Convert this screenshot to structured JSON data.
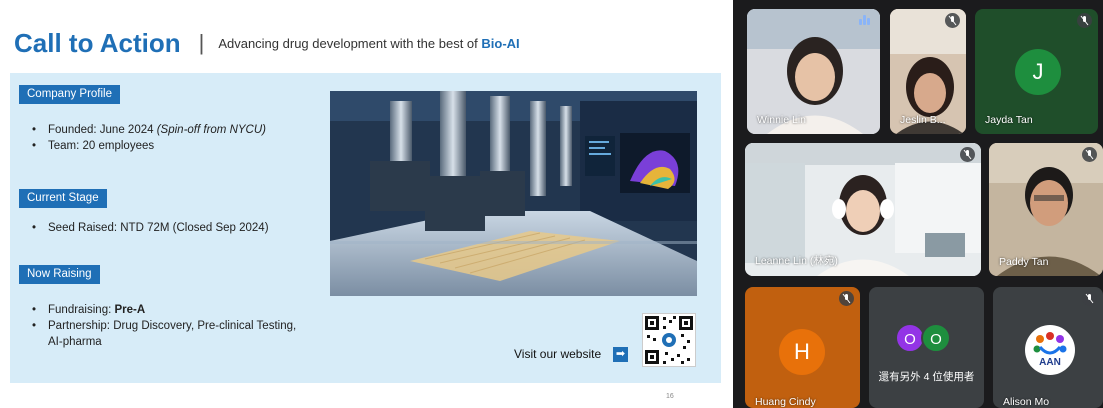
{
  "slide": {
    "title": "Call to Action",
    "separator": "|",
    "subtitle_prefix": "Advancing drug development with the best of",
    "subtitle_highlight": "Bio-AI",
    "sections": {
      "profile": {
        "label": "Company Profile",
        "founded_prefix": "Founded: June 2024",
        "founded_note": "(Spin-off from NYCU)",
        "team": "Team: 20 employees"
      },
      "stage": {
        "label": "Current Stage",
        "seed": "Seed Raised: NTD 72M (Closed Sep 2024)"
      },
      "raising": {
        "label": "Now Raising",
        "fundraising_prefix": "Fundraising:",
        "fundraising_value": "Pre-A",
        "partnership": "Partnership: Drug Discovery, Pre-clinical Testing, AI-pharma"
      }
    },
    "visit_label": "Visit our website",
    "visit_icon": "arrow-right-icon",
    "page_number": "16"
  },
  "meeting": {
    "participants": [
      {
        "name": "Winnie Lin",
        "speaking": true
      },
      {
        "name": "Jeslin B...",
        "muted": true
      },
      {
        "name": "Jayda Tan",
        "initial": "J",
        "muted": true
      },
      {
        "name": "Leanne Lin (林宛)",
        "muted": true
      },
      {
        "name": "Paddy Tan",
        "muted": true
      },
      {
        "name": "Huang Cindy",
        "initial": "H",
        "muted": true
      },
      {
        "name": "Alison Mo",
        "avatar_text": "AAN",
        "muted": true
      }
    ],
    "others": {
      "text": "還有另外 4 位使用者",
      "initials": [
        "O",
        "O"
      ]
    }
  },
  "colors": {
    "brand_blue": "#1f6fb6",
    "panel_bg": "#d7ecf8",
    "jayda_avatar": "#1e8e3e",
    "cindy_avatar": "#e8710a",
    "others_1": "#9334e6",
    "others_2": "#1e8e3e"
  }
}
